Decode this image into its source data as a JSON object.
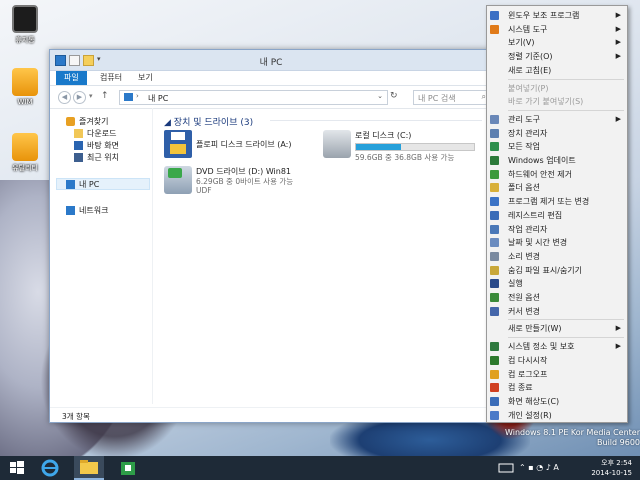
{
  "desktop": {
    "icons": [
      {
        "label": "휴지통",
        "icon": "recycle-bin-icon"
      },
      {
        "label": "WIM",
        "icon": "wim-tool-icon"
      },
      {
        "label": "유틸리티",
        "icon": "utility-icon"
      }
    ],
    "watermark_line1": "Windows 8.1 PE Kor Media Center",
    "watermark_line2": "Build 9600"
  },
  "window": {
    "title": "내 PC",
    "ribbon_tabs": [
      "파일",
      "컴퓨터",
      "보기"
    ],
    "address": "내 PC",
    "search_placeholder": "내 PC 검색",
    "nav": {
      "favorites": "즐겨찾기",
      "downloads": "다운로드",
      "desktop": "바탕 화면",
      "recent": "최근 위치",
      "this_pc": "내 PC",
      "network": "네트워크"
    },
    "group_header": "장치 및 드라이브 (3)",
    "drives": [
      {
        "name": "플로피 디스크 드라이브 (A:)",
        "sub": "",
        "icon": "floppy-drive-icon"
      },
      {
        "name": "로컬 디스크 (C:)",
        "sub": "59.6GB 중 36.8GB 사용 가능",
        "icon": "hard-disk-icon",
        "used_fraction": 0.38
      },
      {
        "name": "DVD 드라이브 (D:) Win81",
        "sub": "6.29GB 중 0바이트 사용 가능",
        "sub2": "UDF",
        "icon": "dvd-drive-icon"
      }
    ],
    "status": "3개 항목"
  },
  "menu": {
    "items": [
      {
        "label": "윈도우 보조 프로그램",
        "arrow": "▶",
        "icon": "accessories-icon",
        "color": "#3b6fc4"
      },
      {
        "label": "시스템 도구",
        "arrow": "▶",
        "icon": "system-tools-icon",
        "color": "#e07a18"
      },
      {
        "label": "보기(V)",
        "arrow": "▶",
        "icon": "",
        "color": ""
      },
      {
        "label": "정렬 기준(O)",
        "arrow": "▶",
        "icon": "",
        "color": ""
      },
      {
        "label": "새로 고침(E)",
        "arrow": "",
        "icon": "",
        "color": ""
      },
      {
        "label": "붙여넣기(P)",
        "arrow": "",
        "icon": "",
        "color": "",
        "disabled": true
      },
      {
        "label": "바로 가기 붙여넣기(S)",
        "arrow": "",
        "icon": "",
        "color": "",
        "disabled": true
      },
      {
        "label": "관리 도구",
        "arrow": "▶",
        "icon": "admin-tools-icon",
        "color": "#6a88b8"
      },
      {
        "label": "장치 관리자",
        "arrow": "",
        "icon": "device-manager-icon",
        "color": "#5c7fb0"
      },
      {
        "label": "모든 작업",
        "arrow": "",
        "icon": "all-tasks-icon",
        "color": "#2d8f4d"
      },
      {
        "label": "Windows 업데이트",
        "arrow": "",
        "icon": "windows-update-icon",
        "color": "#2c7a3a"
      },
      {
        "label": "하드웨어 안전 제거",
        "arrow": "",
        "icon": "safely-remove-icon",
        "color": "#3c9a3c"
      },
      {
        "label": "폴더 옵션",
        "arrow": "",
        "icon": "folder-options-icon",
        "color": "#d8b03a"
      },
      {
        "label": "프로그램 제거 또는 변경",
        "arrow": "",
        "icon": "uninstall-icon",
        "color": "#3b73c6"
      },
      {
        "label": "레지스트리 편집",
        "arrow": "",
        "icon": "registry-icon",
        "color": "#3a6cb8"
      },
      {
        "label": "작업 관리자",
        "arrow": "",
        "icon": "task-manager-icon",
        "color": "#4a78b8"
      },
      {
        "label": "날짜 및 시간 변경",
        "arrow": "",
        "icon": "date-time-icon",
        "color": "#6b8cc0"
      },
      {
        "label": "소리 변경",
        "arrow": "",
        "icon": "sound-icon",
        "color": "#7a8aa0"
      },
      {
        "label": "숨김 파일 표시/숨기기",
        "arrow": "",
        "icon": "hidden-files-icon",
        "color": "#c9a83a"
      },
      {
        "label": "실행",
        "arrow": "",
        "icon": "run-icon",
        "color": "#2a4a8a"
      },
      {
        "label": "전원 옵션",
        "arrow": "",
        "icon": "power-options-icon",
        "color": "#3a8a3a"
      },
      {
        "label": "커서 변경",
        "arrow": "",
        "icon": "cursor-icon",
        "color": "#4466aa"
      },
      {
        "label": "새로 만들기(W)",
        "arrow": "▶",
        "icon": "",
        "color": ""
      },
      {
        "label": "시스템 정소 및 보호",
        "arrow": "▶",
        "icon": "system-protect-icon",
        "color": "#2f7a3f"
      },
      {
        "label": "컴 다시시작",
        "arrow": "",
        "icon": "restart-icon",
        "color": "#2d7a2d"
      },
      {
        "label": "컴 로그오프",
        "arrow": "",
        "icon": "logoff-icon",
        "color": "#e0a020"
      },
      {
        "label": "컴 종료",
        "arrow": "",
        "icon": "shutdown-icon",
        "color": "#d04020"
      },
      {
        "label": "화면 해상도(C)",
        "arrow": "",
        "icon": "display-icon",
        "color": "#3a6cb8"
      },
      {
        "label": "개인 설정(R)",
        "arrow": "",
        "icon": "personalize-icon",
        "color": "#4a7ac8"
      }
    ]
  },
  "taskbar": {
    "time": "오후 2:54",
    "date": "2014-10-15"
  }
}
